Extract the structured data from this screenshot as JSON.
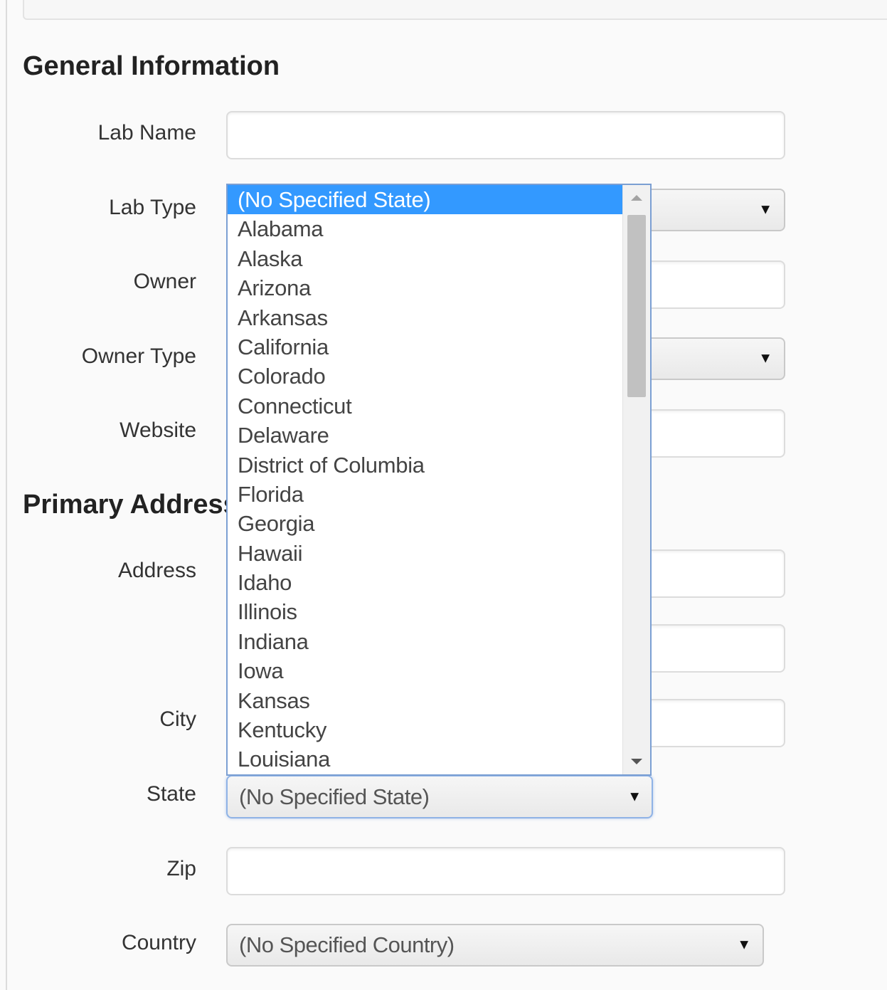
{
  "sections": {
    "general": "General Information",
    "primary_address": "Primary Address"
  },
  "fields": {
    "lab_name": {
      "label": "Lab Name",
      "value": ""
    },
    "lab_type": {
      "label": "Lab Type",
      "value": ""
    },
    "owner": {
      "label": "Owner",
      "value": ""
    },
    "owner_type": {
      "label": "Owner Type",
      "value": ""
    },
    "website": {
      "label": "Website",
      "value": ""
    },
    "address": {
      "label": "Address",
      "value": ""
    },
    "address2": {
      "value": ""
    },
    "city": {
      "label": "City",
      "value": ""
    },
    "state": {
      "label": "State",
      "value": "(No Specified State)"
    },
    "zip": {
      "label": "Zip",
      "value": ""
    },
    "country": {
      "label": "Country",
      "value": "(No Specified Country)"
    }
  },
  "caret_glyph": "▼",
  "state_dropdown": {
    "selected_index": 0,
    "options": [
      "(No Specified State)",
      "Alabama",
      "Alaska",
      "Arizona",
      "Arkansas",
      "California",
      "Colorado",
      "Connecticut",
      "Delaware",
      "District of Columbia",
      "Florida",
      "Georgia",
      "Hawaii",
      "Idaho",
      "Illinois",
      "Indiana",
      "Iowa",
      "Kansas",
      "Kentucky",
      "Louisiana"
    ]
  },
  "colors": {
    "selected_option_bg": "#3399ff",
    "focus_border": "#7b9fd3"
  }
}
